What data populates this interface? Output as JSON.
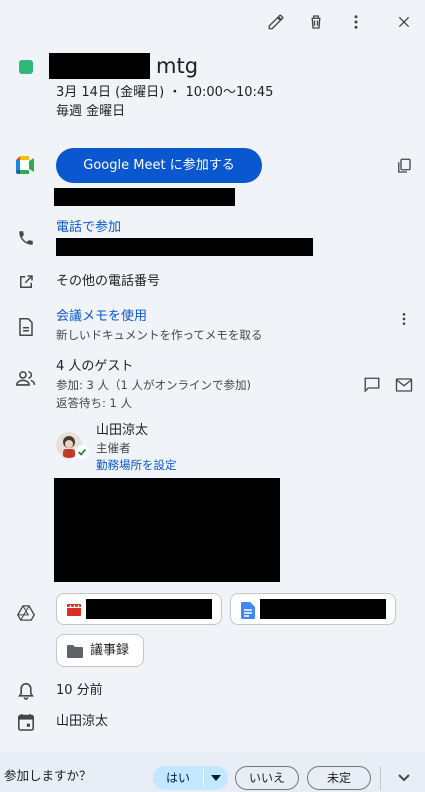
{
  "event": {
    "title_suffix": "mtg",
    "date_time": "3月 14日 (金曜日) ・ 10:00〜10:45",
    "recurrence": "毎週 金曜日",
    "color": "#33b679"
  },
  "meet": {
    "join_label": "Google Meet に参加する"
  },
  "phone": {
    "join_label": "電話で参加"
  },
  "more_phones": {
    "label": "その他の電話番号"
  },
  "notes": {
    "title": "会議メモを使用",
    "subtitle": "新しいドキュメントを作ってメモを取る"
  },
  "guests": {
    "title": "4 人のゲスト",
    "attending": "参加: 3 人（1 人がオンラインで参加)",
    "pending": "返答待ち: 1 人",
    "organizer_name": "山田涼太",
    "organizer_role": "主催者",
    "set_location": "勤務場所を設定"
  },
  "attachments": {
    "folder_label": "議事録"
  },
  "reminder": {
    "label": "10 分前"
  },
  "calendar": {
    "owner": "山田涼太"
  },
  "rsvp": {
    "question": "参加しますか？",
    "yes": "はい",
    "no": "いいえ",
    "maybe": "未定"
  },
  "colors": {
    "accent": "#0b57d0",
    "yes_bg": "#c2e7ff",
    "background": "#f0f4f9"
  }
}
